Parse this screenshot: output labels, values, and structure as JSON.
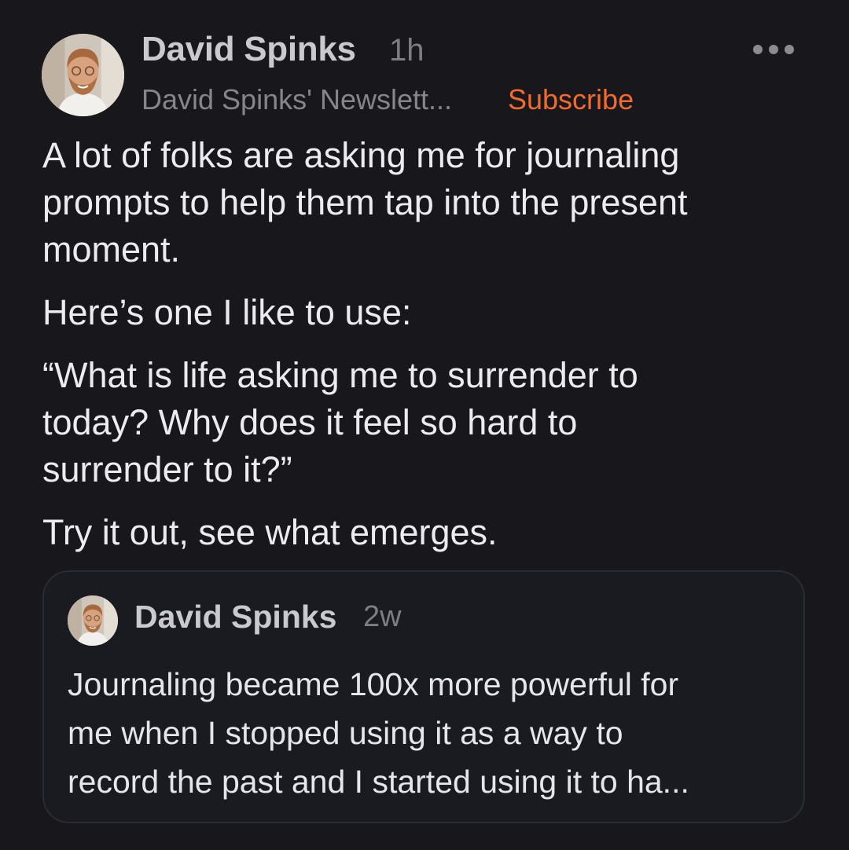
{
  "note": {
    "author_name": "David Spinks",
    "timestamp": "1h",
    "publication": "David Spinks' Newslett...",
    "subscribe_label": "Subscribe",
    "more_icon": "more-horizontal-icon",
    "paragraphs": [
      "A lot of folks are asking me for journaling\nprompts to help them tap into the present\nmoment.",
      "Here’s one I like to use:",
      "“What is life asking me to surrender to\ntoday? Why does it feel so hard to\nsurrender to it?”",
      "Try it out, see what emerges."
    ]
  },
  "quoted_note": {
    "author_name": "David Spinks",
    "timestamp": "2w",
    "text": "Journaling became 100x more powerful for\nme when I stopped using it as a way to\nrecord the past and I started using it to ha..."
  },
  "colors": {
    "background": "#18181c",
    "accent": "#f26a2c",
    "card_border": "#2b2c33"
  }
}
